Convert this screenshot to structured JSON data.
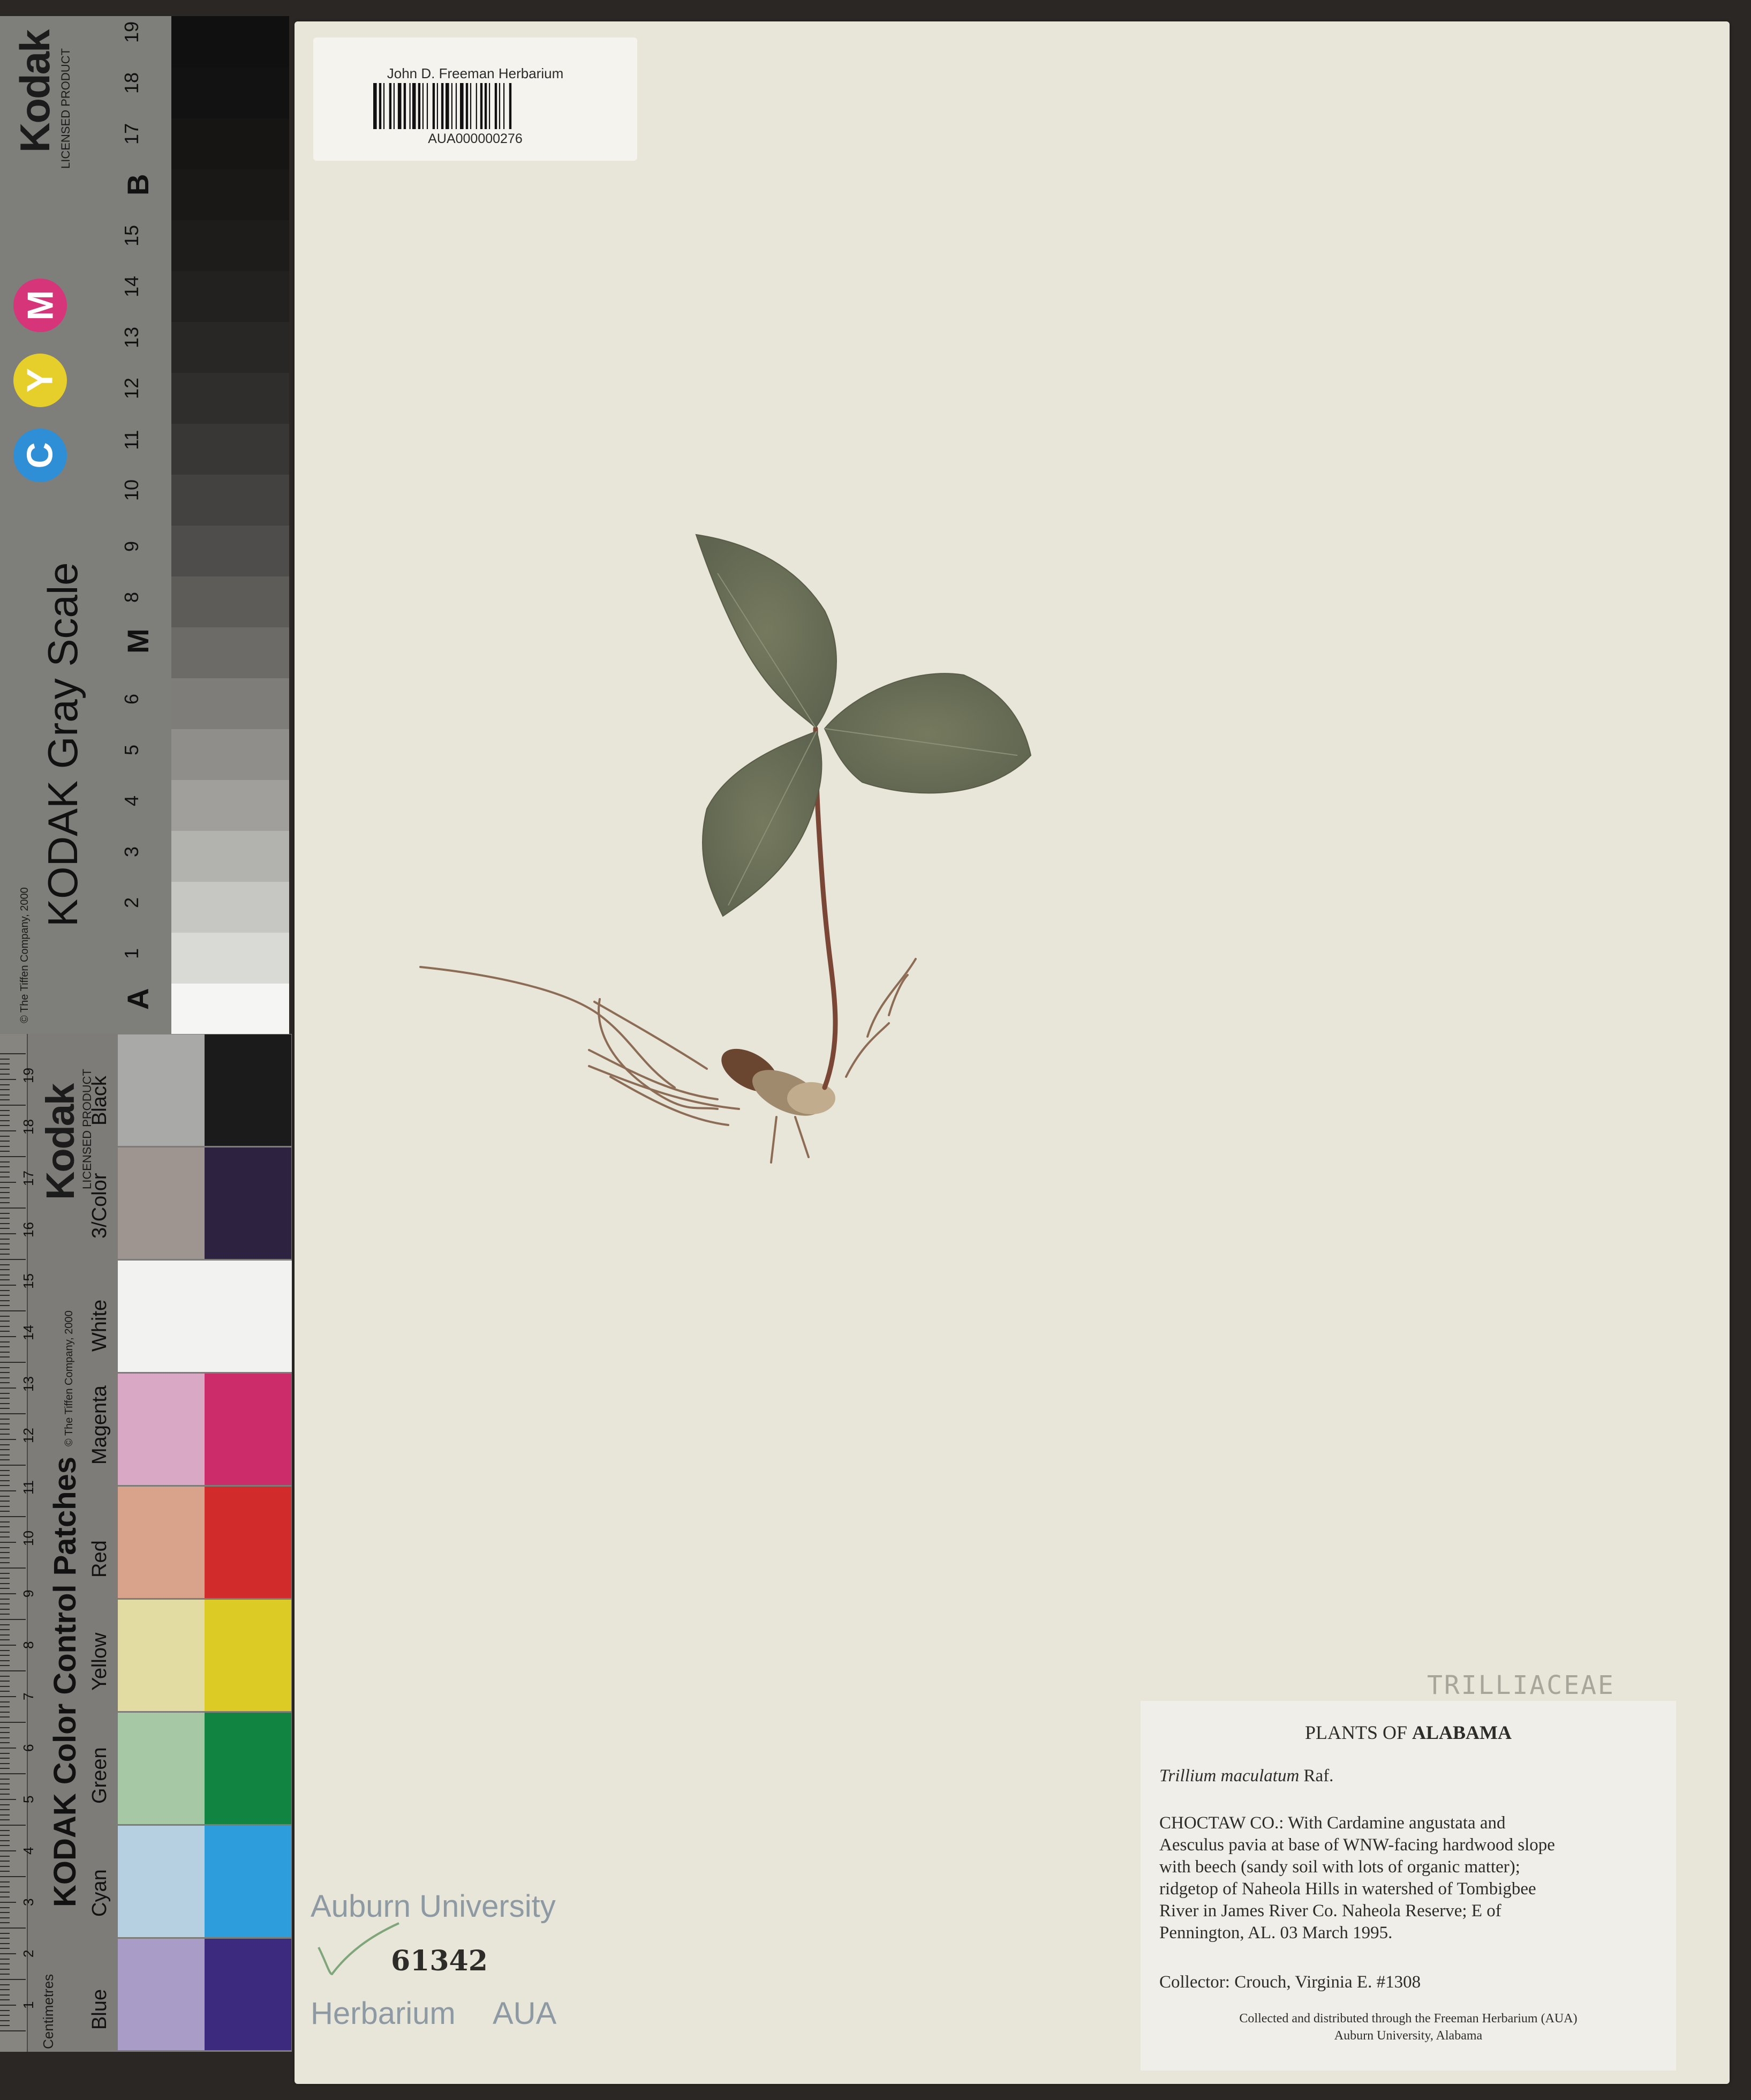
{
  "gray_scale_card": {
    "brand": "Kodak",
    "brand_sub": "LICENSED PRODUCT",
    "title": "KODAK Gray Scale",
    "copyright": "© The Tiffen Company, 2000",
    "cmy": [
      "C",
      "Y",
      "M"
    ],
    "cmy_colors": [
      "#2f8fd6",
      "#e6cf2a",
      "#d6357a"
    ],
    "scale_labels": [
      "A",
      "1",
      "2",
      "3",
      "4",
      "5",
      "6",
      "M",
      "8",
      "9",
      "10",
      "11",
      "12",
      "13",
      "14",
      "15",
      "B",
      "17",
      "18",
      "19"
    ],
    "steps": [
      "#f5f5f3",
      "#d9d9d6",
      "#c6c6c3",
      "#b2b2ae",
      "#a09f9b",
      "#8f8e8a",
      "#7e7d79",
      "#6c6b68",
      "#5d5c59",
      "#4e4d4b",
      "#434240",
      "#383735",
      "#2f2e2d",
      "#282726",
      "#222120",
      "#1d1c1b",
      "#191817",
      "#161514",
      "#131212",
      "#101010"
    ]
  },
  "color_card": {
    "brand": "Kodak",
    "brand_sub": "LICENSED PRODUCT",
    "title": "KODAK Color Control Patches",
    "copyright": "© The Tiffen Company, 2000",
    "ruler_label": "Centimetres",
    "ruler_numbers": [
      "1",
      "2",
      "3",
      "4",
      "5",
      "6",
      "7",
      "8",
      "9",
      "10",
      "11",
      "12",
      "13",
      "14",
      "15",
      "16",
      "17",
      "18",
      "19"
    ],
    "patch_labels": [
      "Blue",
      "Cyan",
      "Green",
      "Yellow",
      "Red",
      "Magenta",
      "White",
      "3/Color",
      "Black"
    ],
    "patches_light": [
      "#a99dc7",
      "#b6cfe1",
      "#a6c8a4",
      "#e2dba2",
      "#d8a38a",
      "#d8a8c4",
      "#f2f2f0",
      "#9f9590",
      "#a9a9a7"
    ],
    "patches_dark": [
      "#3b2a7e",
      "#2e9ddc",
      "#128441",
      "#dccb25",
      "#d12c2b",
      "#cc2c69",
      "#f2f2f0",
      "#2d2340",
      "#1b1b1b"
    ]
  },
  "barcode_label": {
    "institution": "John D. Freeman Herbarium",
    "catalog_number": "AUA000000276"
  },
  "annotation": "TRILLIACEAE",
  "specimen_label": {
    "heading_prefix": "PLANTS OF ",
    "heading_state": "ALABAMA",
    "taxon_name": "Trillium maculatum",
    "taxon_author": "Raf.",
    "locality_lines": [
      "CHOCTAW CO.: With Cardamine angustata and",
      "Aesculus pavia at base of WNW-facing hardwood slope",
      "with beech (sandy soil with lots of organic matter);",
      "ridgetop of Naheola Hills in watershed of Tombigbee",
      "River in James River Co. Naheola Reserve; E of",
      "Pennington, AL. 03 March 1995."
    ],
    "collector": "Collector: Crouch, Virginia E. #1308",
    "footer_1": "Collected and distributed through the Freeman Herbarium (AUA)",
    "footer_2": "Auburn University, Alabama"
  },
  "stamp": {
    "university": "Auburn University",
    "accession": "61342",
    "herbarium": "Herbarium",
    "code": "AUA"
  },
  "colors": {
    "sheet": "#e8e6d9",
    "leaf": "#6f7358",
    "stem": "#7a4a38",
    "root": "#8a6a52"
  }
}
